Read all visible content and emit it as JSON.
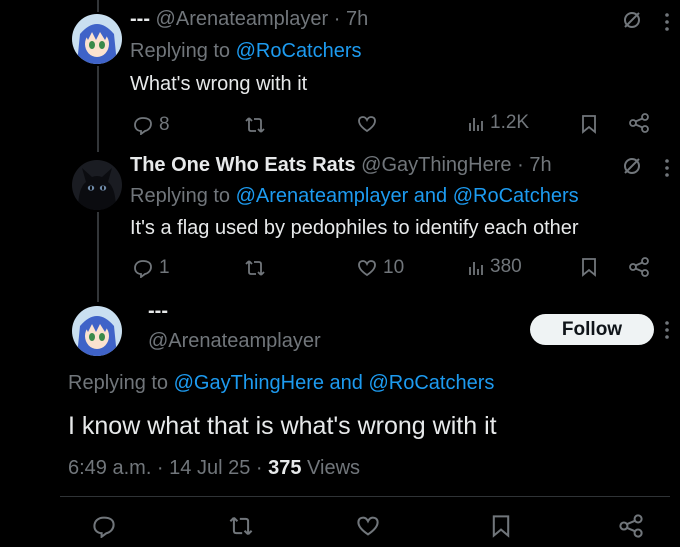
{
  "tweets": [
    {
      "name": "---",
      "handle": "@Arenateamplayer",
      "sep": "·",
      "time": "7h",
      "replying_prefix": "Replying to",
      "replying_to": "@RoCatchers",
      "text": "What's wrong with it",
      "replies": "8",
      "retweets": "",
      "likes": "",
      "views": "1.2K"
    },
    {
      "name": "The One Who Eats Rats",
      "handle": "@GayThingHere",
      "sep": "·",
      "time": "7h",
      "replying_prefix": "Replying to",
      "replying_to": "@Arenateamplayer and @RoCatchers",
      "text": "It's a flag used by pedophiles to identify each other",
      "replies": "1",
      "retweets": "",
      "likes": "10",
      "views": "380"
    }
  ],
  "main_tweet": {
    "name": "---",
    "handle": "@Arenateamplayer",
    "follow_label": "Follow",
    "replying_prefix": "Replying to",
    "replying_to": "@GayThingHere and @RoCatchers",
    "text": "I know what that is what's wrong with it",
    "timestamp": "6:49 a.m. · 14 Jul 25 ·",
    "views_count": "375",
    "views_label": "Views"
  },
  "colors": {
    "background": "#000000",
    "text": "#e7e9ea",
    "muted": "#71767b",
    "link": "#1d9bf0",
    "follow_bg": "#eff3f4"
  },
  "icons": [
    "grok-icon",
    "more-icon",
    "reply-icon",
    "retweet-icon",
    "like-icon",
    "views-icon",
    "bookmark-icon",
    "share-icon"
  ]
}
